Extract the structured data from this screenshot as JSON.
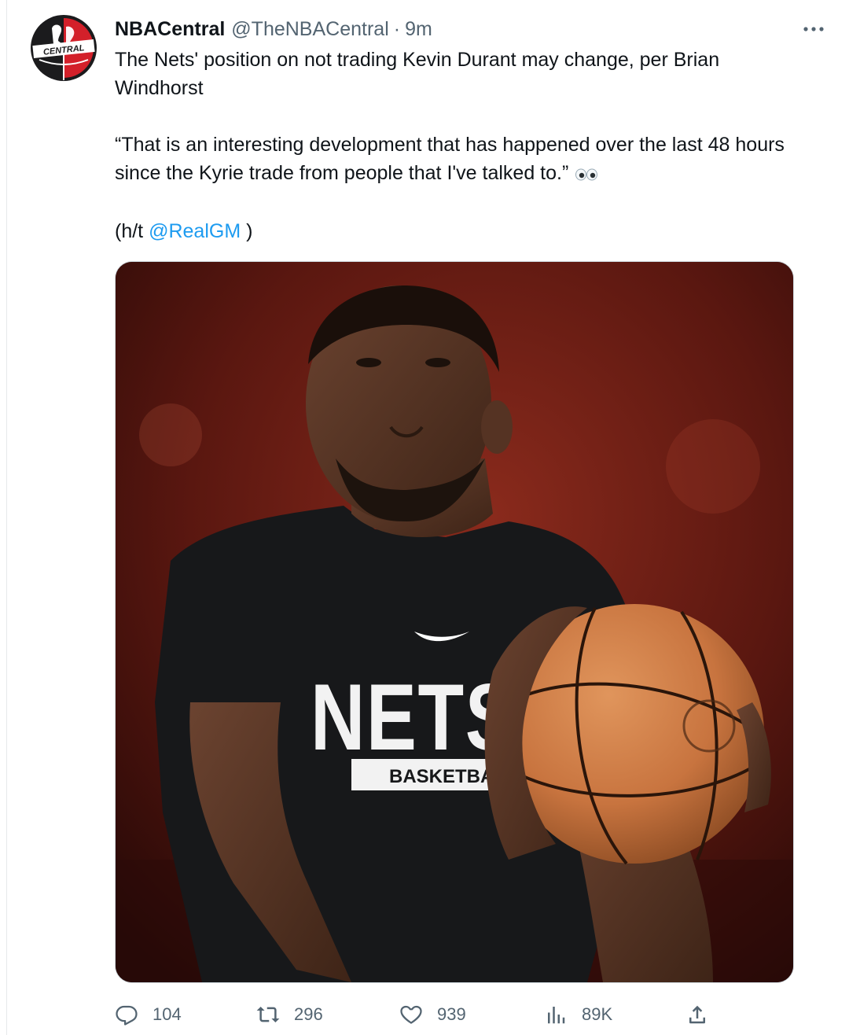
{
  "tweet": {
    "display_name": "NBACentral",
    "handle": "@TheNBACentral",
    "separator": "·",
    "time": "9m",
    "avatar_text": "CENTRAL",
    "text_line1": "The Nets' position on not trading Kevin Durant may change, per Brian Windhorst",
    "text_quote": "“That is an interesting development that has happened over the last 48 hours since the Kyrie trade from people that I've talked to.”",
    "ht_prefix": "(h/t ",
    "ht_mention": "@RealGM",
    "ht_suffix": " )"
  },
  "media": {
    "shirt_team": "NETS",
    "shirt_sub": "BASKETBALL"
  },
  "actions": {
    "replies": "104",
    "retweets": "296",
    "likes": "939",
    "views": "89K"
  },
  "colors": {
    "link": "#1d9bf0",
    "secondary_text": "#536471",
    "primary_text": "#0f1419"
  }
}
